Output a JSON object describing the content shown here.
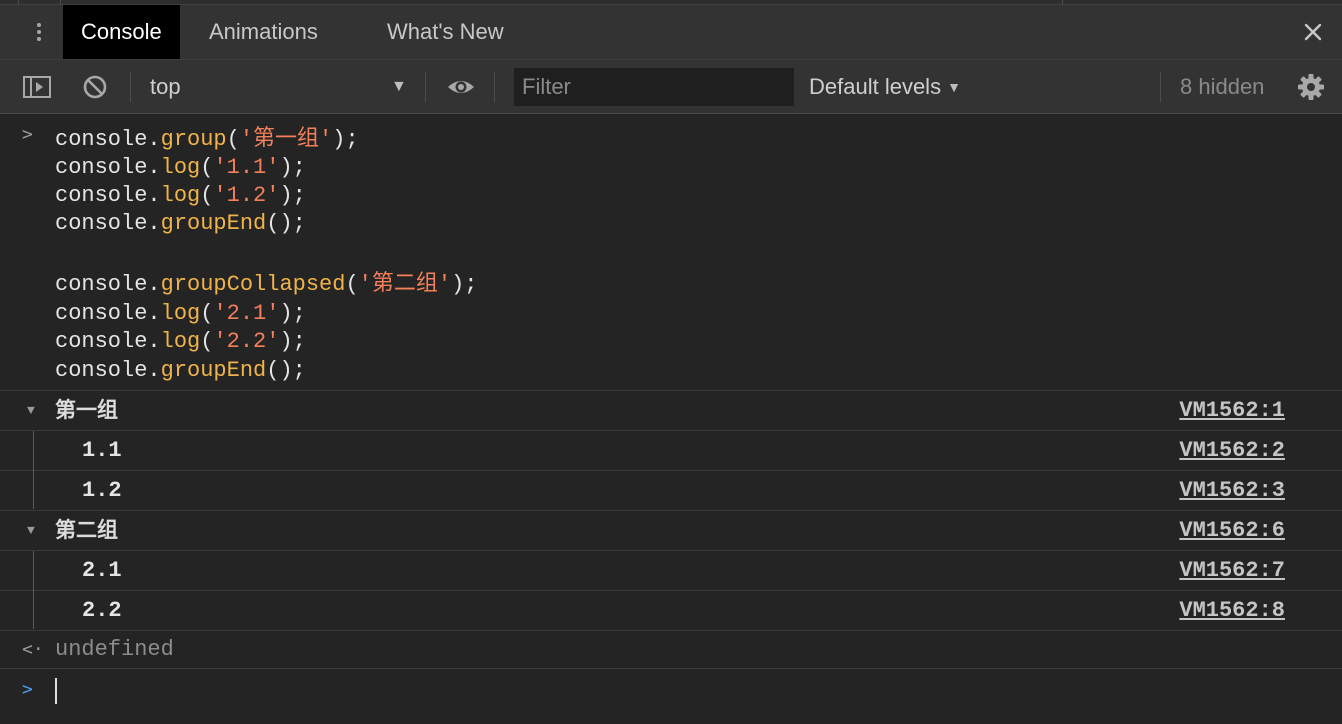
{
  "tabs": {
    "items": [
      {
        "label": "Console",
        "active": true
      },
      {
        "label": "Animations",
        "active": false
      },
      {
        "label": "What's New",
        "active": false
      }
    ],
    "close_icon": "close-icon",
    "menu_icon": "kebab-menu-icon"
  },
  "toolbar": {
    "sidebar_icon": "sidebar-toggle-icon",
    "clear_icon": "clear-console-icon",
    "context": "top",
    "context_arrow": "▼",
    "eye_icon": "eye-icon",
    "filter_placeholder": "Filter",
    "levels": "Default levels",
    "levels_arrow": "▼",
    "hidden": "8 hidden",
    "settings_icon": "gear-icon"
  },
  "input": {
    "prompt": ">",
    "lines": [
      {
        "obj": "console.",
        "fn": "group",
        "open": "(",
        "arg": "'第一组'",
        "close": ");"
      },
      {
        "obj": "console.",
        "fn": "log",
        "open": "(",
        "arg": "'1.1'",
        "close": ");"
      },
      {
        "obj": "console.",
        "fn": "log",
        "open": "(",
        "arg": "'1.2'",
        "close": ");"
      },
      {
        "obj": "console.",
        "fn": "groupEnd",
        "open": "(",
        "arg": "",
        "close": ");"
      },
      {
        "obj": "console.",
        "fn": "groupCollapsed",
        "open": "(",
        "arg": "'第二组'",
        "close": ");"
      },
      {
        "obj": "console.",
        "fn": "log",
        "open": "(",
        "arg": "'2.1'",
        "close": ");"
      },
      {
        "obj": "console.",
        "fn": "log",
        "open": "(",
        "arg": "'2.2'",
        "close": ");"
      },
      {
        "obj": "console.",
        "fn": "groupEnd",
        "open": "(",
        "arg": "",
        "close": ");"
      }
    ]
  },
  "output": {
    "groups": [
      {
        "title": "第一组",
        "source": "VM1562:1",
        "expanded": true,
        "entries": [
          {
            "value": "1.1",
            "source": "VM1562:2"
          },
          {
            "value": "1.2",
            "source": "VM1562:3"
          }
        ]
      },
      {
        "title": "第二组",
        "source": "VM1562:6",
        "expanded": true,
        "entries": [
          {
            "value": "2.1",
            "source": "VM1562:7"
          },
          {
            "value": "2.2",
            "source": "VM1562:8"
          }
        ]
      }
    ],
    "group_toggle": "▼",
    "result_arrow": "<·",
    "result": "undefined",
    "prompt": ">"
  },
  "colors": {
    "background": "#242424",
    "function": "#f0b34a",
    "string": "#f3805a",
    "prompt": "#4a9cf0"
  }
}
